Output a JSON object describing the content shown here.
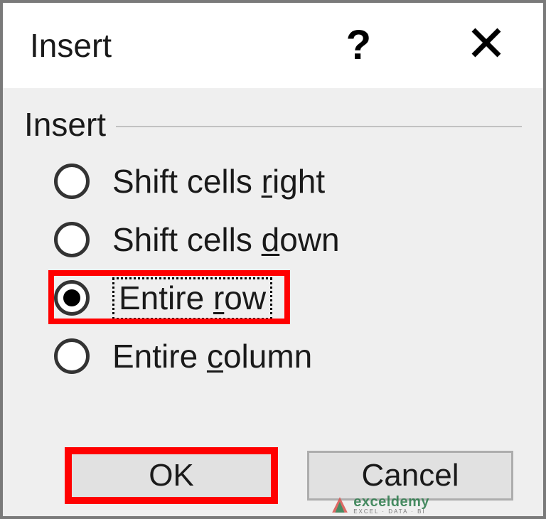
{
  "dialog": {
    "title": "Insert",
    "help_tooltip": "?",
    "close_tooltip": "×"
  },
  "group": {
    "label": "Insert"
  },
  "options": {
    "shift_right_pre": "Shift cells ",
    "shift_right_u": "r",
    "shift_right_post": "ight",
    "shift_down_pre": "Shift cells ",
    "shift_down_u": "d",
    "shift_down_post": "own",
    "entire_row_pre": "Entire ",
    "entire_row_u": "r",
    "entire_row_post": "ow",
    "entire_col_pre": "Entire ",
    "entire_col_u": "c",
    "entire_col_post": "olumn",
    "selected": "entire_row"
  },
  "buttons": {
    "ok": "OK",
    "cancel": "Cancel"
  },
  "watermark": {
    "brand": "exceldemy",
    "tagline": "EXCEL · DATA · BI"
  }
}
